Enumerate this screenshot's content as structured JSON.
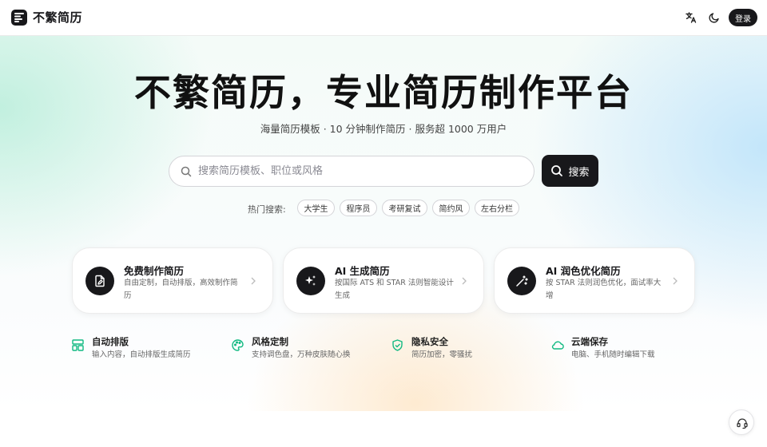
{
  "header": {
    "brand": "不繁简历",
    "login_label": "登录",
    "icons": [
      "logo-icon",
      "translate-icon",
      "moon-icon"
    ]
  },
  "hero": {
    "title": "不繁简历，专业简历制作平台",
    "subtitle": "海量简历模板 · 10 分钟制作简历 · 服务超 1000 万用户"
  },
  "search": {
    "placeholder": "搜索简历模板、职位或风格",
    "value": "",
    "button_label": "搜索"
  },
  "hot": {
    "label": "热门搜索:",
    "tags": [
      "大学生",
      "程序员",
      "考研复试",
      "简约风",
      "左右分栏"
    ]
  },
  "features": [
    {
      "title": "免费制作简历",
      "desc": "自由定制，自动排版，高效制作简历",
      "icon": "resume-edit-icon"
    },
    {
      "title": "AI 生成简历",
      "desc": "按国际 ATS 和 STAR 法则智能设计生成",
      "icon": "sparkles-icon"
    },
    {
      "title": "AI 润色优化简历",
      "desc": "按 STAR 法则润色优化，面试率大增",
      "icon": "magic-wand-icon"
    }
  ],
  "perks": [
    {
      "title": "自动排版",
      "desc": "输入内容，自动排版生成简历",
      "icon": "layout-icon"
    },
    {
      "title": "风格定制",
      "desc": "支持调色盘，万种皮肤随心换",
      "icon": "palette-icon"
    },
    {
      "title": "隐私安全",
      "desc": "简历加密，零骚扰",
      "icon": "shield-check-icon"
    },
    {
      "title": "云端保存",
      "desc": "电脑、手机随时编辑下载",
      "icon": "cloud-icon"
    }
  ],
  "colors": {
    "accent_dark": "#18181b",
    "perk_icon": "#10b981"
  }
}
